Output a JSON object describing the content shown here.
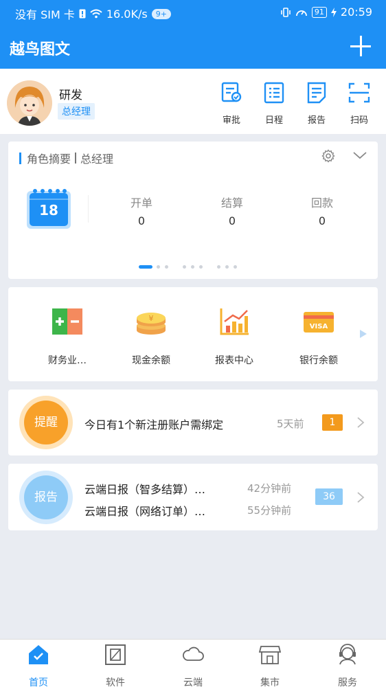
{
  "status_bar": {
    "carrier": "没有 SIM 卡",
    "speed": "16.0K/s",
    "notif_count": "9+",
    "battery": "91",
    "time": "20:59"
  },
  "header": {
    "title": "越鸟图文"
  },
  "profile": {
    "name": "研发",
    "role": "总经理",
    "quick_actions": [
      {
        "label": "审批",
        "icon": "approval-icon"
      },
      {
        "label": "日程",
        "icon": "schedule-icon"
      },
      {
        "label": "报告",
        "icon": "report-icon"
      },
      {
        "label": "扫码",
        "icon": "scan-icon"
      }
    ]
  },
  "summary": {
    "title": "角色摘要",
    "role": "总经理",
    "calendar_day": "18",
    "stats": [
      {
        "label": "开单",
        "value": "0"
      },
      {
        "label": "结算",
        "value": "0"
      },
      {
        "label": "回款",
        "value": "0"
      }
    ]
  },
  "shortcuts": [
    {
      "label": "财务业…",
      "icon": "finance-icon"
    },
    {
      "label": "现金余额",
      "icon": "cash-coins-icon"
    },
    {
      "label": "报表中心",
      "icon": "chart-icon"
    },
    {
      "label": "银行余额",
      "icon": "visa-card-icon"
    }
  ],
  "reminder": {
    "badge": "提醒",
    "message": "今日有1个新注册账户需绑定",
    "time": "5天前",
    "count": "1"
  },
  "report": {
    "badge": "报告",
    "items": [
      {
        "message": "云端日报（智多结算）…",
        "time": "42分钟前"
      },
      {
        "message": "云端日报（网络订单）…",
        "time": "55分钟前"
      }
    ],
    "count": "36"
  },
  "bottom_nav": [
    {
      "label": "首页",
      "active": true
    },
    {
      "label": "软件"
    },
    {
      "label": "云端"
    },
    {
      "label": "集市"
    },
    {
      "label": "服务"
    }
  ],
  "colors": {
    "primary": "#1e90f5",
    "orange": "#f8a12a",
    "light_blue": "#8ecbf7",
    "background": "#e9ecf2"
  }
}
